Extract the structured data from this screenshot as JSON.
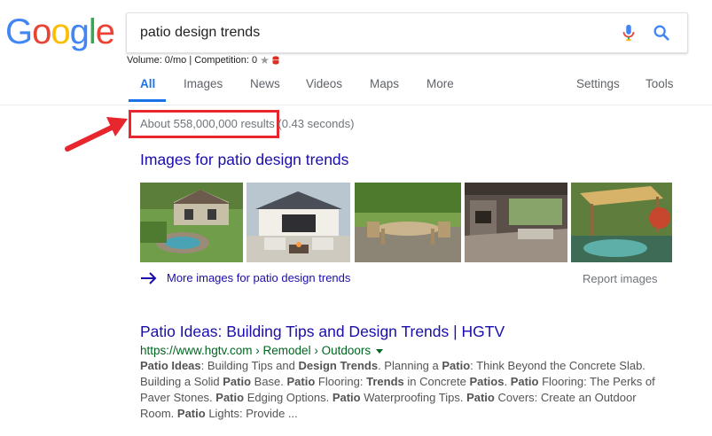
{
  "logo": {
    "letters": [
      "G",
      "o",
      "o",
      "g",
      "l",
      "e"
    ],
    "colors": [
      "#4285F4",
      "#EA4335",
      "#FBBC05",
      "#4285F4",
      "#34A853",
      "#EA4335"
    ]
  },
  "search": {
    "query": "patio design trends",
    "mic_icon": "mic-icon",
    "search_icon": "search-icon"
  },
  "seo_bar": {
    "text": "Volume: 0/mo | Competition: 0",
    "star_icon": "star-icon",
    "db_icon": "database-icon"
  },
  "tabs": {
    "all": "All",
    "images": "Images",
    "news": "News",
    "videos": "Videos",
    "maps": "Maps",
    "more": "More",
    "settings": "Settings",
    "tools": "Tools"
  },
  "stats": {
    "results": "About 558,000,000 results",
    "time": "(0.43 seconds)"
  },
  "annotation": {
    "highlight_color": "#e8262e"
  },
  "images_section": {
    "heading": "Images for patio design trends",
    "more_link": "More images for patio design trends",
    "report": "Report images"
  },
  "result": {
    "title": "Patio Ideas: Building Tips and Design Trends | HGTV",
    "url": "https://www.hgtv.com › Remodel › Outdoors",
    "snippet_parts": [
      [
        "Patio Ideas",
        true
      ],
      [
        ": Building Tips and ",
        false
      ],
      [
        "Design Trends",
        true
      ],
      [
        ". Planning a ",
        false
      ],
      [
        "Patio",
        true
      ],
      [
        ": Think Beyond the Concrete Slab. Building a Solid ",
        false
      ],
      [
        "Patio",
        true
      ],
      [
        " Base. ",
        false
      ],
      [
        "Patio",
        true
      ],
      [
        " Flooring: ",
        false
      ],
      [
        "Trends",
        true
      ],
      [
        " in Concrete ",
        false
      ],
      [
        "Patios",
        true
      ],
      [
        ". ",
        false
      ],
      [
        "Patio",
        true
      ],
      [
        " Flooring: The Perks of Paver Stones. ",
        false
      ],
      [
        "Patio",
        true
      ],
      [
        " Edging Options. ",
        false
      ],
      [
        "Patio",
        true
      ],
      [
        " Waterproofing Tips. ",
        false
      ],
      [
        "Patio",
        true
      ],
      [
        " Covers: Create an Outdoor Room. ",
        false
      ],
      [
        "Patio",
        true
      ],
      [
        " Lights: Provide ...",
        false
      ]
    ]
  },
  "colors": {
    "link": "#1a0dab",
    "url": "#006621",
    "accent": "#1a73e8"
  }
}
